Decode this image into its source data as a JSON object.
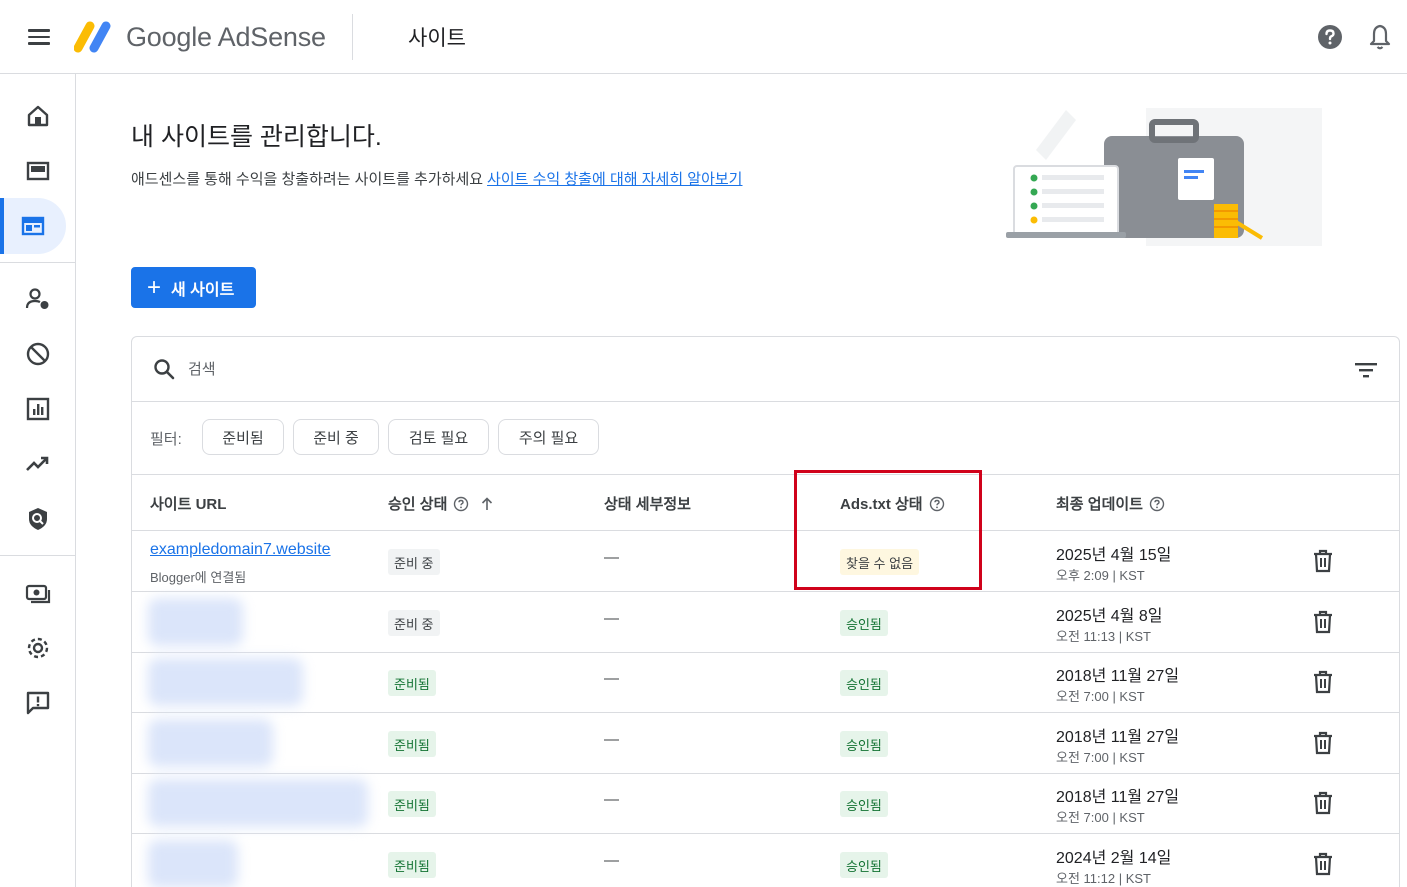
{
  "topbar": {
    "brand": "Google AdSense",
    "title": "사이트"
  },
  "hero": {
    "title": "내 사이트를 관리합니다.",
    "subtitle": "애드센스를 통해 수익을 창출하려는 사이트를 추가하세요",
    "learn_more": "사이트 수익 창출에 대해 자세히 알아보기"
  },
  "new_site_button": {
    "plus": "+",
    "label": "새 사이트"
  },
  "search": {
    "placeholder": "검색"
  },
  "filters": {
    "label": "필터:",
    "chips": [
      "준비됨",
      "준비 중",
      "검토 필요",
      "주의 필요"
    ]
  },
  "table": {
    "headers": {
      "site_url": "사이트 URL",
      "approval_status": "승인 상태",
      "status_details": "상태 세부정보",
      "ads_txt_status": "Ads.txt 상태",
      "last_updated": "최종 업데이트"
    },
    "rows": [
      {
        "url": "exampledomain7.website",
        "url_sub": "Blogger에 연결됨",
        "approval": "준비 중",
        "details": "—",
        "ads_txt": "찾을 수 없음",
        "date": "2025년 4월 15일",
        "time": "오후 2:09 | KST"
      },
      {
        "url": "",
        "url_sub": "",
        "approval": "준비 중",
        "details": "—",
        "ads_txt": "승인됨",
        "date": "2025년 4월 8일",
        "time": "오전 11:13 | KST"
      },
      {
        "url": "",
        "url_sub": "",
        "approval": "준비됨",
        "details": "—",
        "ads_txt": "승인됨",
        "date": "2018년 11월 27일",
        "time": "오전 7:00 | KST"
      },
      {
        "url": "",
        "url_sub": "",
        "approval": "준비됨",
        "details": "—",
        "ads_txt": "승인됨",
        "date": "2018년 11월 27일",
        "time": "오전 7:00 | KST"
      },
      {
        "url": "",
        "url_sub": "",
        "approval": "준비됨",
        "details": "—",
        "ads_txt": "승인됨",
        "date": "2018년 11월 27일",
        "time": "오전 7:00 | KST"
      },
      {
        "url": "",
        "url_sub": "",
        "approval": "준비됨",
        "details": "—",
        "ads_txt": "승인됨",
        "date": "2024년 2월 14일",
        "time": "오전 11:12 | KST"
      }
    ]
  },
  "sidenav": {
    "icons": [
      "home-icon",
      "ads-icon",
      "sites-icon",
      "account-icon",
      "block-icon",
      "reports-icon",
      "optimization-icon",
      "privacy-icon",
      "payments-icon",
      "settings-icon",
      "feedback-icon"
    ]
  },
  "colors": {
    "accent": "#1a73e8",
    "highlight_box": "#d0021b",
    "ready_badge_bg": "#e6f4ea",
    "not_found_badge_bg": "#fef7e0"
  }
}
